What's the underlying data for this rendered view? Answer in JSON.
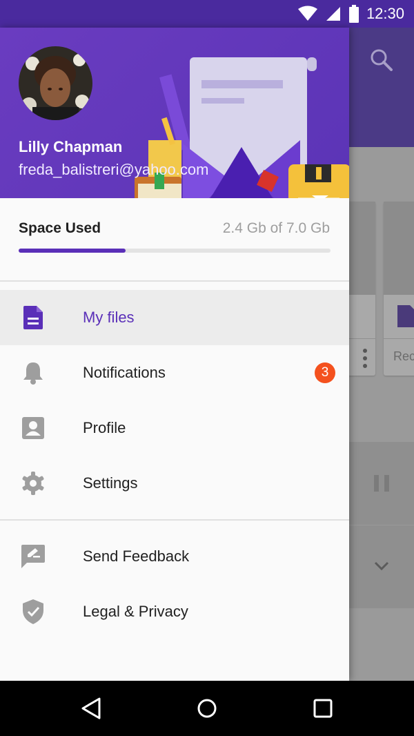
{
  "status_bar": {
    "time": "12:30"
  },
  "user": {
    "name": "Lilly Chapman",
    "email": "freda_balistreri@yahoo.com"
  },
  "storage": {
    "label": "Space Used",
    "value": "2.4 Gb of 7.0 Gb",
    "used_fraction": 0.343
  },
  "menu": [
    {
      "label": "My files",
      "icon": "file-icon",
      "active": true
    },
    {
      "label": "Notifications",
      "icon": "bell-icon",
      "badge": "3"
    },
    {
      "label": "Profile",
      "icon": "profile-icon"
    },
    {
      "label": "Settings",
      "icon": "gear-icon"
    }
  ],
  "secondary_menu": [
    {
      "label": "Send Feedback",
      "icon": "feedback-icon"
    },
    {
      "label": "Legal & Privacy",
      "icon": "shield-icon"
    }
  ],
  "background_app": {
    "card_text": "Rec"
  },
  "colors": {
    "primary": "#5a2fb8",
    "badge": "#f4511e",
    "header": "#6a3cc0"
  }
}
